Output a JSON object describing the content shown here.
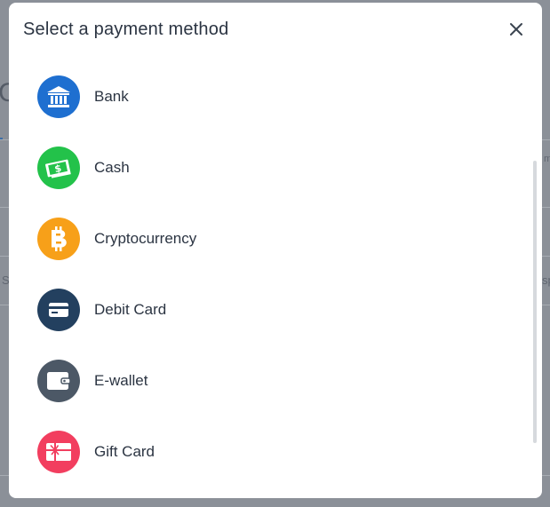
{
  "modal": {
    "title": "Select a payment method",
    "close_icon": "close-icon"
  },
  "payment_methods": [
    {
      "label": "Bank",
      "icon": "bank-icon",
      "color": "#1e6fd0"
    },
    {
      "label": "Cash",
      "icon": "cash-icon",
      "color": "#23c24a"
    },
    {
      "label": "Cryptocurrency",
      "icon": "bitcoin-icon",
      "color": "#f7a019"
    },
    {
      "label": "Debit Card",
      "icon": "card-icon",
      "color": "#23405f"
    },
    {
      "label": "E-wallet",
      "icon": "wallet-icon",
      "color": "#4c5866"
    },
    {
      "label": "Gift Card",
      "icon": "gift-card-icon",
      "color": "#f23e5f"
    }
  ],
  "background": {
    "letter": "C",
    "left_fragment": "S",
    "right_fragment": "sp",
    "right_fragment_top": "m"
  }
}
